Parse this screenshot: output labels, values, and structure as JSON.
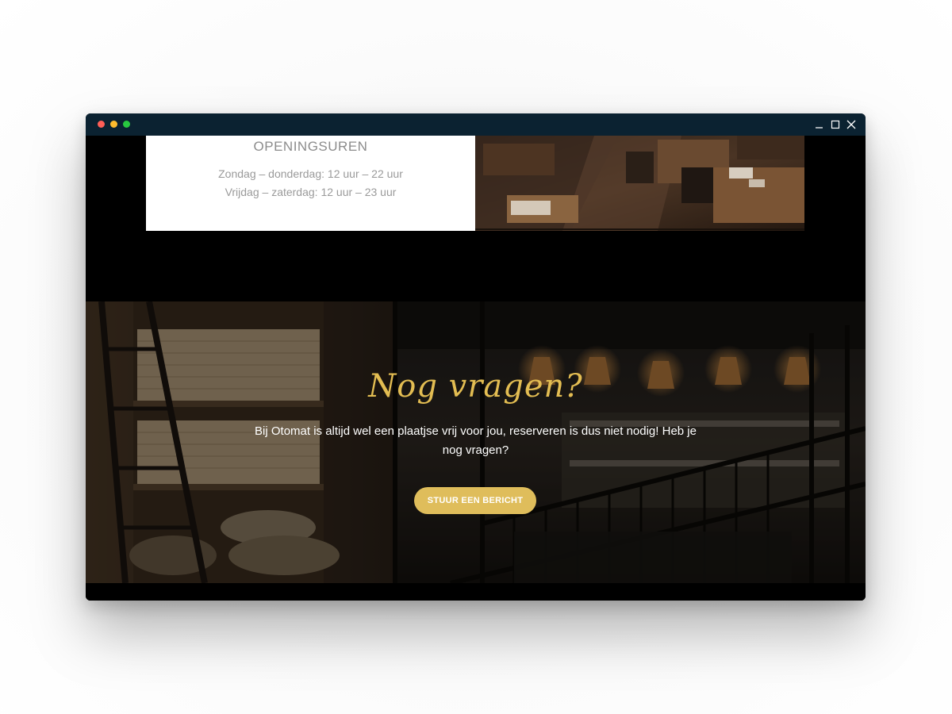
{
  "window": {
    "controls": {
      "minimize_icon": "minimize-icon",
      "maximize_icon": "maximize-icon",
      "close_icon": "close-icon"
    }
  },
  "hours": {
    "title": "OPENINGSUREN",
    "lines": [
      "Zondag – donderdag: 12 uur – 22 uur",
      "Vrijdag – zaterdag: 12 uur – 23 uur"
    ]
  },
  "cta": {
    "heading": "Nog vragen?",
    "text": "Bij Otomat is altijd wel een plaatjse vrij voor jou, reserveren is dus niet nodig! Heb je nog vragen?",
    "button_label": "STUUR EEN BERICHT"
  },
  "colors": {
    "titlebar": "#0b2231",
    "accent_gold": "#dfbd5b",
    "heading_gold": "#e3bd52",
    "page_bg": "#000000"
  }
}
